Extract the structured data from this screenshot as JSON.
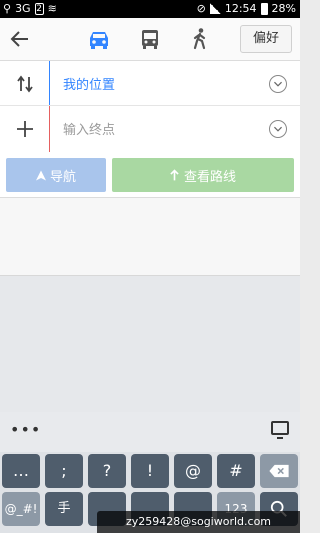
{
  "status_bar": {
    "network": "3G",
    "sim": "2",
    "time": "12:54",
    "battery": "28%"
  },
  "header": {
    "back_icon": "arrow-left-icon",
    "modes": [
      {
        "name": "car-icon",
        "active": true
      },
      {
        "name": "bus-icon",
        "active": false
      },
      {
        "name": "walk-icon",
        "active": false
      }
    ],
    "preference_label": "偏好"
  },
  "route": {
    "start_text": "我的位置",
    "end_placeholder": "输入终点",
    "swap_icon": "swap-icon",
    "add_icon": "plus-icon"
  },
  "actions": {
    "navigate_label": "导航",
    "view_route_label": "查看路线"
  },
  "keyboard": {
    "more_label": "•••",
    "row1": [
      "…",
      ";",
      "?",
      "!",
      "@",
      "#"
    ],
    "row2": [
      "@_#!",
      "手",
      "123"
    ]
  },
  "watermark": "zy259428@sogiworld.com",
  "colors": {
    "accent": "#3385ff",
    "nav_button": "#a9c5ec",
    "route_button": "#a9d8a2",
    "end_marker": "#e56060"
  }
}
